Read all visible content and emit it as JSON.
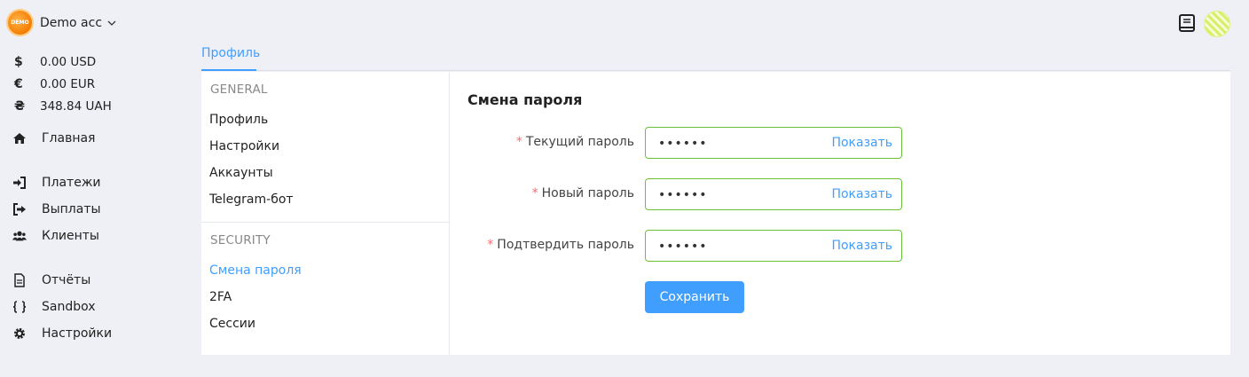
{
  "account": {
    "logo_text": "DEMO",
    "name": "Demo acc"
  },
  "balances": [
    {
      "symbol": "$",
      "amount": "0.00 USD"
    },
    {
      "symbol": "€",
      "amount": "0.00 EUR"
    },
    {
      "symbol": "₴",
      "amount": "348.84 UAH"
    }
  ],
  "nav": {
    "home": "Главная",
    "payments": "Платежи",
    "payouts": "Выплаты",
    "clients": "Клиенты",
    "reports": "Отчёты",
    "sandbox": "Sandbox",
    "settings": "Настройки"
  },
  "tabs": {
    "profile": "Профиль"
  },
  "submenu": {
    "general_title": "GENERAL",
    "general_items": [
      "Профиль",
      "Настройки",
      "Аккаунты",
      "Telegram-бот"
    ],
    "security_title": "SECURITY",
    "security_items": [
      "Смена пароля",
      "2FA",
      "Сессии"
    ]
  },
  "form": {
    "title": "Смена пароля",
    "required_mark": "*",
    "fields": [
      {
        "label": "Текущий пароль",
        "value": "••••••",
        "show": "Показать"
      },
      {
        "label": "Новый пароль",
        "value": "••••••",
        "show": "Показать"
      },
      {
        "label": "Подтвердить пароль",
        "value": "••••••",
        "show": "Показать"
      }
    ],
    "save_label": "Сохранить"
  },
  "colors": {
    "accent": "#409eff",
    "valid_border": "#67c23a",
    "required": "#f56c6c"
  },
  "icons": {
    "home": "home-icon",
    "payments": "sign-in-icon",
    "payouts": "sign-out-icon",
    "clients": "users-icon",
    "reports": "file-icon",
    "sandbox": "braces-icon",
    "settings": "gear-icon",
    "docs": "book-icon"
  }
}
